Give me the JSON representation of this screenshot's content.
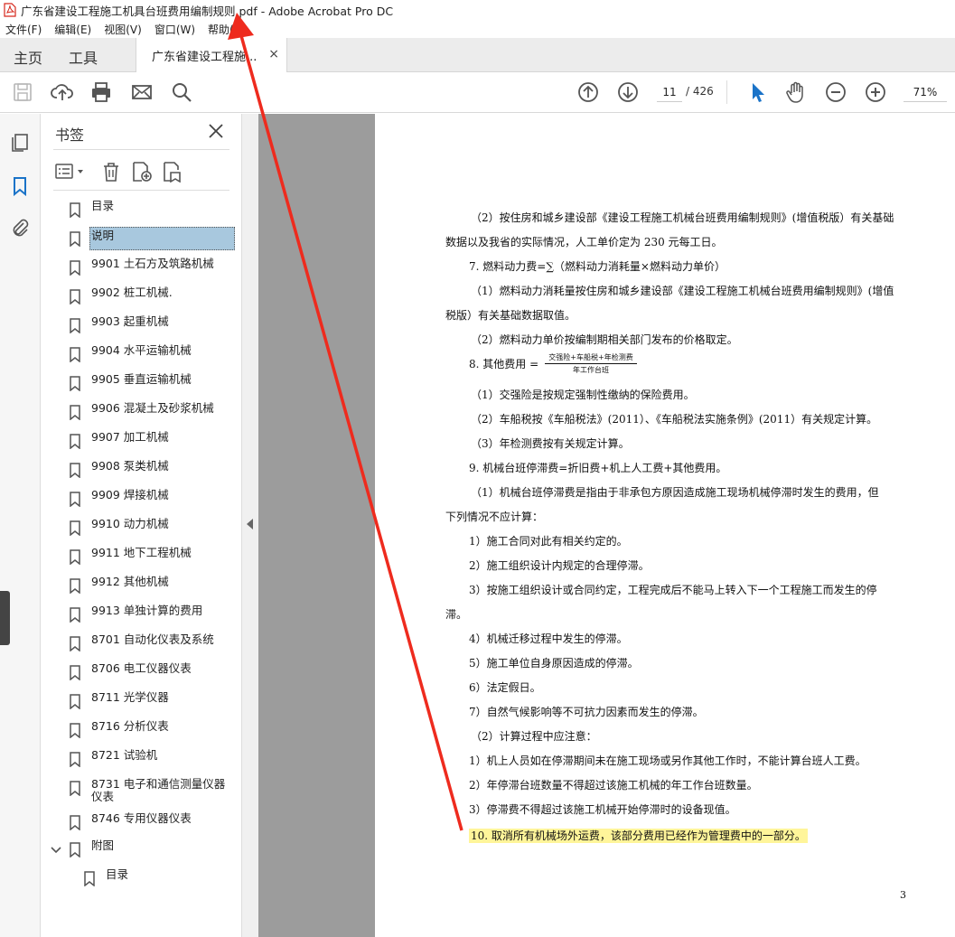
{
  "window": {
    "title": "广东省建设工程施工机具台班费用编制规则.pdf - Adobe Acrobat Pro DC"
  },
  "menu": [
    "文件(F)",
    "编辑(E)",
    "视图(V)",
    "窗口(W)",
    "帮助(H)"
  ],
  "tabs": {
    "home": "主页",
    "tools": "工具",
    "document": "广东省建设工程施...",
    "close_symbol": "×"
  },
  "toolbar": {
    "current_page": "11",
    "total_pages": "/ 426",
    "zoom": "71%"
  },
  "bookmarks_panel": {
    "title": "书签",
    "items": [
      {
        "label": "目录"
      },
      {
        "label": "说明",
        "selected": true
      },
      {
        "label": "9901 土石方及筑路机械"
      },
      {
        "label": "9902 桩工机械."
      },
      {
        "label": "9903 起重机械"
      },
      {
        "label": "9904 水平运输机械"
      },
      {
        "label": "9905 垂直运输机械"
      },
      {
        "label": "9906 混凝土及砂浆机械"
      },
      {
        "label": "9907 加工机械"
      },
      {
        "label": "9908 泵类机械"
      },
      {
        "label": "9909 焊接机械"
      },
      {
        "label": "9910 动力机械"
      },
      {
        "label": "9911 地下工程机械"
      },
      {
        "label": "9912 其他机械"
      },
      {
        "label": "9913 单独计算的费用"
      },
      {
        "label": "8701 自动化仪表及系统"
      },
      {
        "label": "8706 电工仪器仪表"
      },
      {
        "label": "8711 光学仪器"
      },
      {
        "label": "8716 分析仪表"
      },
      {
        "label": "8721 试验机"
      },
      {
        "label": "8731 电子和通信测量仪器仪表"
      },
      {
        "label": "8746 专用仪器仪表"
      },
      {
        "label": "附图",
        "expanded": true
      },
      {
        "label": "目录",
        "child": true
      }
    ]
  },
  "document": {
    "lines": [
      "（2）按住房和城乡建设部《建设工程施工机械台班费用编制规则》(增值税版）有关基础",
      "数据以及我省的实际情况，人工单价定为 230 元每工日。",
      "7.  燃料动力费=∑（燃料动力消耗量×燃料动力单价）",
      "（1）燃料动力消耗量按住房和城乡建设部《建设工程施工机械台班费用编制规则》(增值",
      "税版）有关基础数据取值。",
      "（2）燃料动力单价按编制期相关部门发布的价格取定。",
      "8.  其他费用 =",
      "（1）交强险是按规定强制性缴纳的保险费用。",
      "（2）车船税按《车船税法》(2011）、《车船税法实施条例》(2011）有关规定计算。",
      "（3）年检测费按有关规定计算。",
      "9.  机械台班停滞费=折旧费+机上人工费+其他费用。",
      "（1）机械台班停滞费是指由于非承包方原因造成施工现场机械停滞时发生的费用，但",
      "下列情况不应计算：",
      "1）施工合同对此有相关约定的。",
      "2）施工组织设计内规定的合理停滞。",
      "3）按施工组织设计或合同约定，工程完成后不能马上转入下一个工程施工而发生的停",
      "滞。",
      "4）机械迁移过程中发生的停滞。",
      "5）施工单位自身原因造成的停滞。",
      "6）法定假日。",
      "7）自然气候影响等不可抗力因素而发生的停滞。",
      "（2）计算过程中应注意：",
      "1）机上人员如在停滞期间未在施工现场或另作其他工作时，不能计算台班人工费。",
      "2）年停滞台班数量不得超过该施工机械的年工作台班数量。",
      "3）停滞费不得超过该施工机械开始停滞时的设备现值。",
      "10.  取消所有机械场外运费，该部分费用已经作为管理费中的一部分。"
    ],
    "fraction_numerator": "交强险+车船税+年检测费",
    "fraction_denominator": "年工作台班",
    "page_number": "3"
  },
  "colors": {
    "annotation_arrow": "#ee2b1e",
    "highlight": "#fff59a",
    "selected_bookmark": "#a8c8de",
    "gutter": "#9c9c9c",
    "acrobat_red": "#d6271c",
    "accent_blue": "#1a73c8"
  }
}
